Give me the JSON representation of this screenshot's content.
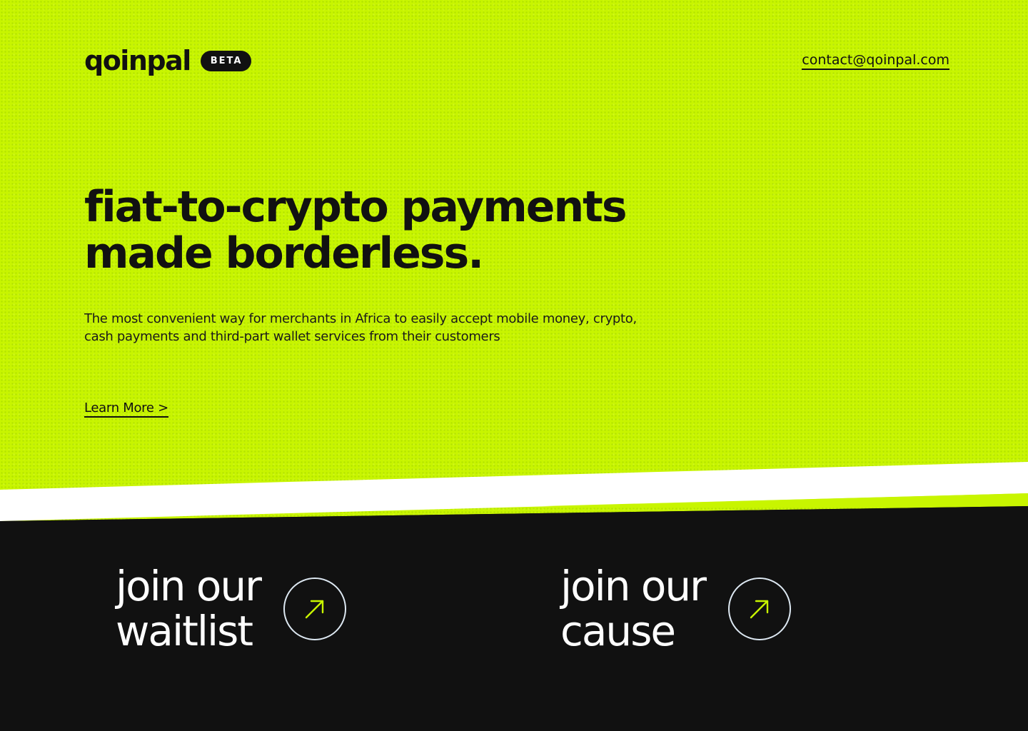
{
  "header": {
    "logo": "qoinpal",
    "badge": "BETA",
    "contact_email": "contact@qoinpal.com"
  },
  "hero": {
    "headline_line1": "fiat-to-crypto payments",
    "headline_line2": "made borderless.",
    "description_line1": "The most convenient way for merchants in Africa to easily accept mobile money, crypto,",
    "description_line2": "cash payments and third-part wallet services from their customers",
    "learn_more": "Learn More >"
  },
  "cta": {
    "waitlist_line1": "join our",
    "waitlist_line2": "waitlist",
    "cause_line1": "join our",
    "cause_line2": "cause",
    "arrow_icon": "arrow-up-right-icon"
  },
  "colors": {
    "accent_lime": "#c8f500",
    "dark_background": "#111111",
    "white_band": "#ffffff",
    "circle_border": "#dde8f2"
  }
}
